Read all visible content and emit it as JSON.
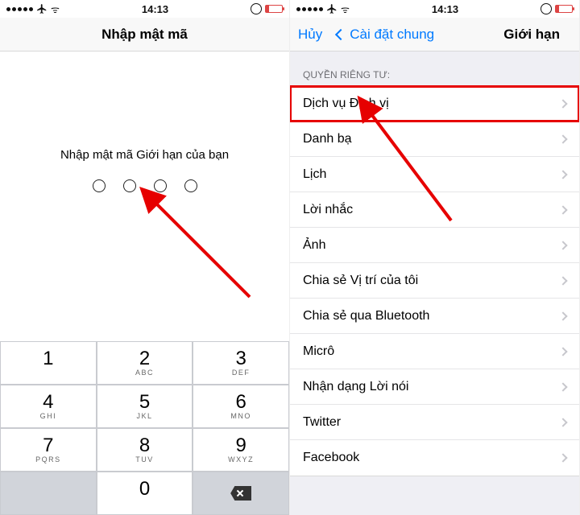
{
  "status": {
    "time": "14:13"
  },
  "left_screen": {
    "nav_title": "Nhập mật mã",
    "prompt": "Nhập mật mã Giới hạn của bạn",
    "keypad": [
      {
        "num": "1",
        "letters": ""
      },
      {
        "num": "2",
        "letters": "ABC"
      },
      {
        "num": "3",
        "letters": "DEF"
      },
      {
        "num": "4",
        "letters": "GHI"
      },
      {
        "num": "5",
        "letters": "JKL"
      },
      {
        "num": "6",
        "letters": "MNO"
      },
      {
        "num": "7",
        "letters": "PQRS"
      },
      {
        "num": "8",
        "letters": "TUV"
      },
      {
        "num": "9",
        "letters": "WXYZ"
      },
      {
        "num": "",
        "letters": "",
        "blank": true
      },
      {
        "num": "0",
        "letters": ""
      },
      {
        "num": "",
        "letters": "",
        "backspace": true
      }
    ]
  },
  "right_screen": {
    "nav_cancel": "Hủy",
    "nav_back": "Cài đặt chung",
    "nav_title": "Giới hạn",
    "section_header": "QUYỀN RIÊNG TƯ:",
    "rows": [
      {
        "label": "Dịch vụ Định vị",
        "highlight": true
      },
      {
        "label": "Danh bạ"
      },
      {
        "label": "Lịch"
      },
      {
        "label": "Lời nhắc"
      },
      {
        "label": "Ảnh"
      },
      {
        "label": "Chia sẻ Vị trí của tôi"
      },
      {
        "label": "Chia sẻ qua Bluetooth"
      },
      {
        "label": "Micrô"
      },
      {
        "label": "Nhận dạng Lời nói"
      },
      {
        "label": "Twitter"
      },
      {
        "label": "Facebook"
      }
    ]
  }
}
